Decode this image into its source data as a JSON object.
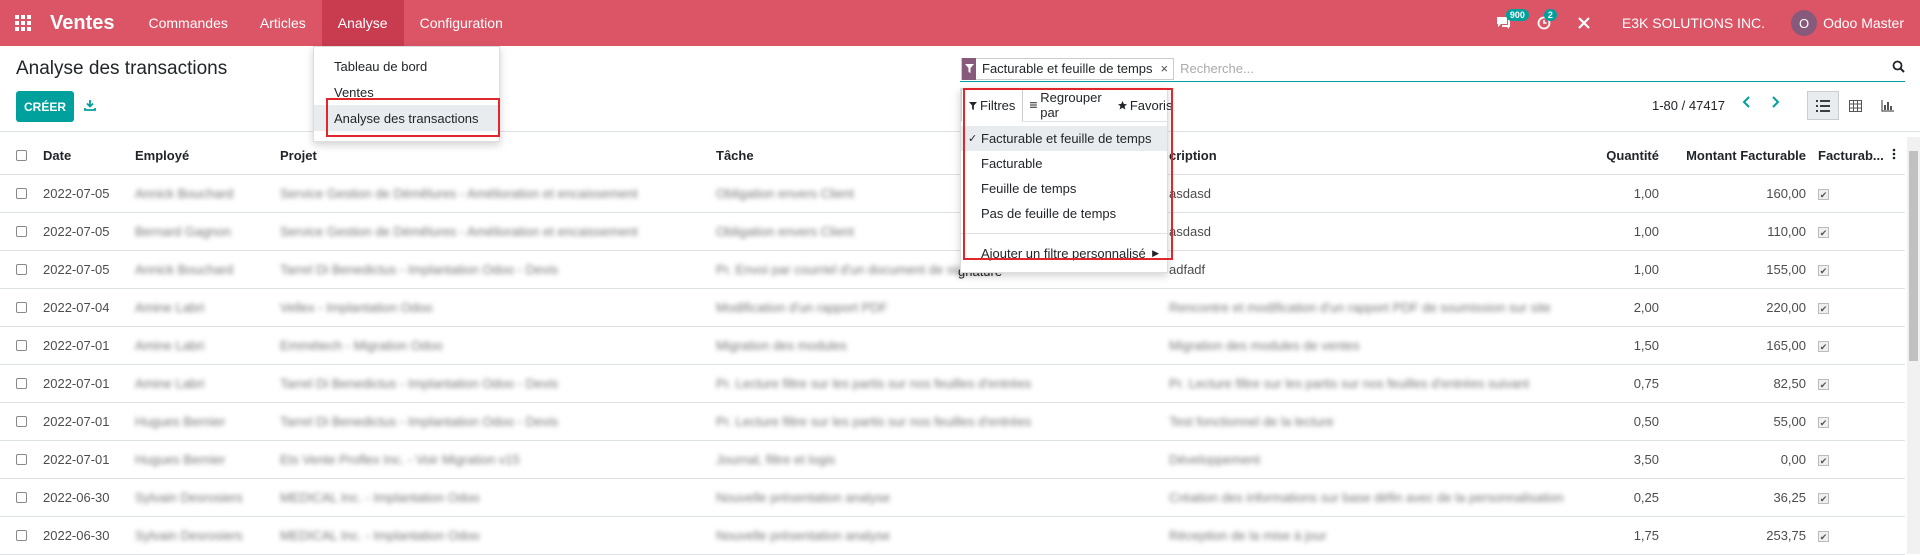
{
  "navbar": {
    "brand": "Ventes",
    "menu": [
      "Commandes",
      "Articles",
      "Analyse",
      "Configuration"
    ],
    "chat_badge": "900",
    "activity_badge": "2",
    "company": "E3K SOLUTIONS INC.",
    "user_initial": "O",
    "user_name": "Odoo Master"
  },
  "control": {
    "title": "Analyse des transactions",
    "create_label": "CRÉER",
    "facet_value": "Facturable et feuille de temps",
    "facet_remove": "×",
    "search_placeholder": "Recherche...",
    "pager": "1-80 / 47417"
  },
  "analyse_menu": [
    "Tableau de bord",
    "Ventes",
    "Analyse des transactions"
  ],
  "filter_panel": {
    "tabs": [
      "Filtres",
      "Regrouper par",
      "Favoris"
    ],
    "items": [
      "Facturable et feuille de temps",
      "Facturable",
      "Feuille de temps",
      "Pas de feuille de temps"
    ],
    "custom": "Ajouter un filtre personnalisé"
  },
  "table": {
    "headers": [
      "Date",
      "Employé",
      "Projet",
      "Tâche",
      "Description",
      "Quantité",
      "Montant Facturable",
      "Facturab..."
    ],
    "header_desc_visible": "cription",
    "rows": [
      {
        "date": "2022-07-05",
        "emp": "Annick Bouchard",
        "proj": "Service Gestion de Démêlures - Amélioration et encaissement",
        "task": "Obligation envers Client",
        "desc": "asdasd",
        "qty": "1,00",
        "amt": "160,00"
      },
      {
        "date": "2022-07-05",
        "emp": "Bernard Gagnon",
        "proj": "Service Gestion de Démêlures - Amélioration et encaissement",
        "task": "Obligation envers Client",
        "desc": "asdasd",
        "qty": "1,00",
        "amt": "110,00"
      },
      {
        "date": "2022-07-05",
        "emp": "Annick Bouchard",
        "proj": "Tarrel Di Benedictus - Implantation Odoo - Devis",
        "task": "Pr. Envoi par courriel d'un document de signature",
        "desc": "adfadf",
        "qty": "1,00",
        "amt": "155,00"
      },
      {
        "date": "2022-07-04",
        "emp": "Amine Labri",
        "proj": "Vellex - Implantation Odoo",
        "task": "Modification d'un rapport PDF",
        "desc": "Rencontre et modification d'un rapport PDF de soumission sur site",
        "qty": "2,00",
        "amt": "220,00"
      },
      {
        "date": "2022-07-01",
        "emp": "Amine Labri",
        "proj": "Emmétech - Migration Odoo",
        "task": "Migration des modules",
        "desc": "Migration des modules de ventes",
        "qty": "1,50",
        "amt": "165,00"
      },
      {
        "date": "2022-07-01",
        "emp": "Amine Labri",
        "proj": "Tarrel Di Benedictus - Implantation Odoo - Devis",
        "task": "Pr. Lecture filtre sur les partis sur nos feuilles d'entrées",
        "desc": "Pr. Lecture filtre sur les partis sur nos feuilles d'entrées suivant",
        "qty": "0,75",
        "amt": "82,50"
      },
      {
        "date": "2022-07-01",
        "emp": "Hugues Bernier",
        "proj": "Tarrel Di Benedictus - Implantation Odoo - Devis",
        "task": "Pr. Lecture filtre sur les partis sur nos feuilles d'entrées",
        "desc": "Test fonctionnel de la lecture",
        "qty": "0,50",
        "amt": "55,00"
      },
      {
        "date": "2022-07-01",
        "emp": "Hugues Bernier",
        "proj": "Ets Vente Proflex Inc. - Voir Migration v15",
        "task": "Journal, filtre et logis",
        "desc": "Développement",
        "qty": "3,50",
        "amt": "0,00"
      },
      {
        "date": "2022-06-30",
        "emp": "Sylvain Desrosiers",
        "proj": "MEDICAL Inc. - Implantation Odoo",
        "task": "Nouvelle présentation analyse",
        "desc": "Création des informations sur base défin avec de la personnalisation",
        "qty": "0,25",
        "amt": "36,25"
      },
      {
        "date": "2022-06-30",
        "emp": "Sylvain Desrosiers",
        "proj": "MEDICAL Inc. - Implantation Odoo",
        "task": "Nouvelle présentation analyse",
        "desc": "Réception de la mise à jour",
        "qty": "1,75",
        "amt": "253,75"
      }
    ]
  },
  "ghost_text": "gnature"
}
